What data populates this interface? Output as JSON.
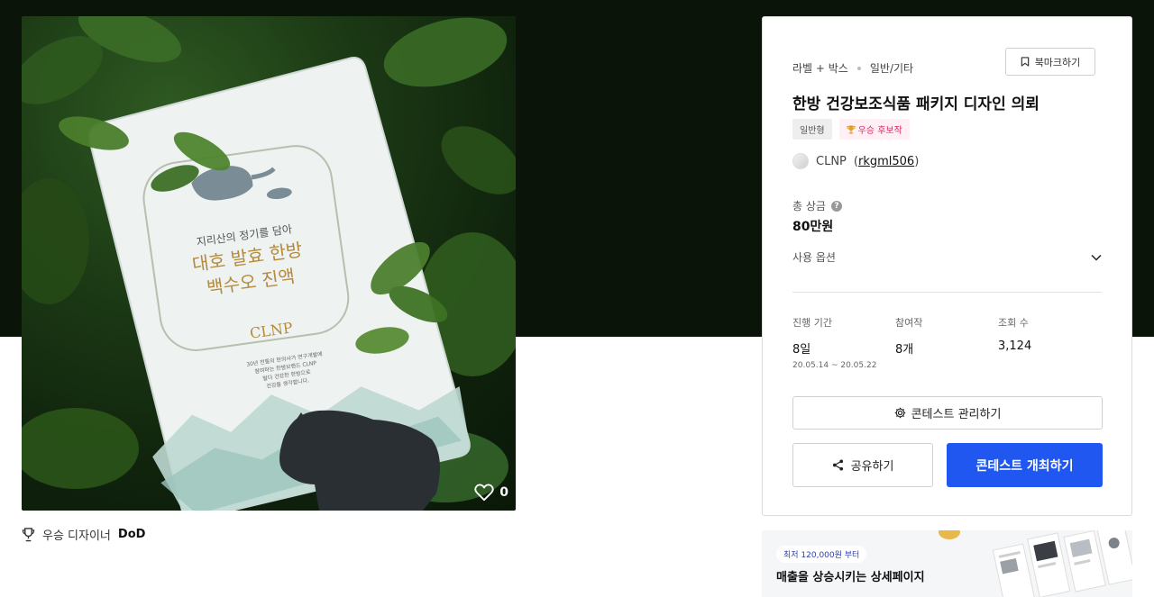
{
  "artwork": {
    "alt": "",
    "package_subtitle": "지리산의 정기를 담아",
    "package_title_line1": "대호 발효 한방",
    "package_title_line2": "백수오 진액",
    "package_brand": "CLNP",
    "package_desc": [
      "30년 전통의 한의사가 연구개발에",
      "참여하는 한방브랜드 CLNP",
      "발다 건강한 한방으로",
      "건강을 생각합니다."
    ],
    "like_count": "0"
  },
  "winner_note": {
    "label": "우승 디자이너",
    "designer": "DoD"
  },
  "panel": {
    "category_primary": "라벨 + 박스",
    "category_secondary": "일반/기타",
    "bookmark_label": "북마크하기",
    "title": "한방 건강보조식품 패키지 디자인 의뢰",
    "tags": {
      "type": "일반형",
      "award": "우승 후보작"
    },
    "host": {
      "name": "CLNP",
      "id": "rkgml506",
      "id_open": "(",
      "id_close": ")"
    },
    "prize": {
      "label": "총 상금",
      "help": "?",
      "value": "80만원"
    },
    "options_label": "사용 옵션",
    "stats": {
      "duration": {
        "label": "진행 기간",
        "value": "8일",
        "range": "20.05.14 ~ 20.05.22"
      },
      "entries": {
        "label": "참여작",
        "value": "8개"
      },
      "views": {
        "label": "조회 수",
        "value": "3,124"
      }
    },
    "manage_button": "콘테스트 관리하기",
    "share_button": "공유하기",
    "host_contest_button": "콘테스트 개최하기"
  },
  "ad": {
    "price_badge": "최저 120,000원 부터",
    "headline": "매출을 상승시키는 상세페이지"
  },
  "colors": {
    "hero_background": "#0b1409",
    "primary_button": "#2057f0",
    "award_tag_text": "#d32a6a",
    "award_tag_bg": "#fff0f5"
  },
  "icons": {
    "like": "heart-outline-icon",
    "winner": "trophy-outline-icon",
    "bookmark": "bookmark-icon",
    "award": "trophy-icon",
    "help": "question-circle-icon",
    "options": "chevron-down-icon",
    "manage": "gear-icon",
    "share": "share-icon"
  }
}
